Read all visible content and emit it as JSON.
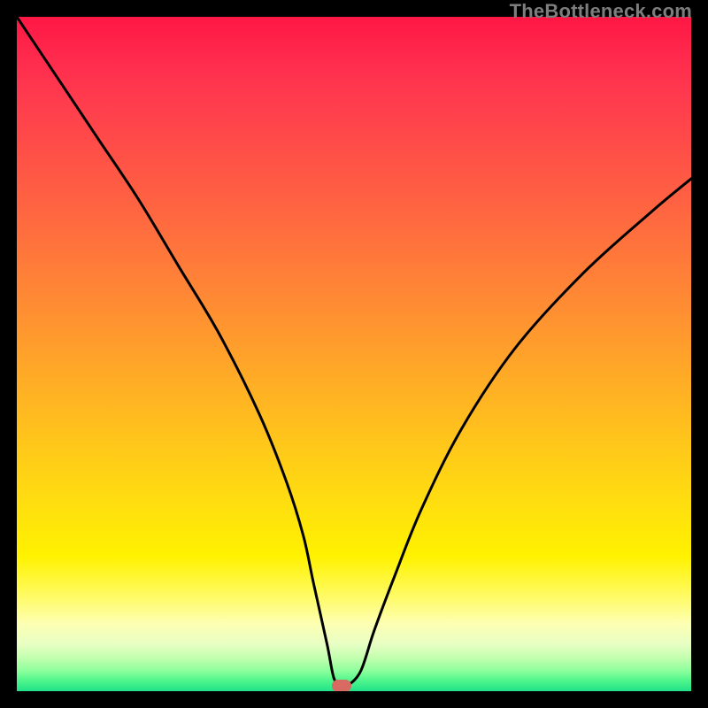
{
  "watermark": "TheBottleneck.com",
  "chart_data": {
    "type": "line",
    "title": "",
    "xlabel": "",
    "ylabel": "",
    "xlim": [
      0,
      100
    ],
    "ylim": [
      0,
      100
    ],
    "grid": false,
    "legend": false,
    "series": [
      {
        "name": "bottleneck-curve",
        "x": [
          0,
          6,
          12,
          18,
          24,
          30,
          36,
          40,
          42.5,
          44,
          46,
          47,
          48,
          49,
          51,
          53,
          56,
          60,
          66,
          74,
          84,
          94,
          100
        ],
        "y": [
          100,
          91,
          82,
          73,
          63,
          53,
          41,
          31,
          23,
          16,
          7,
          2,
          0.8,
          0.8,
          3,
          9,
          17,
          27,
          39,
          51,
          62,
          71,
          76
        ]
      }
    ],
    "marker": {
      "x": 48.2,
      "y": 0.8
    },
    "background_gradient": {
      "top": "#ff1744",
      "mid": "#ffde10",
      "bottom": "#21e28a"
    }
  }
}
